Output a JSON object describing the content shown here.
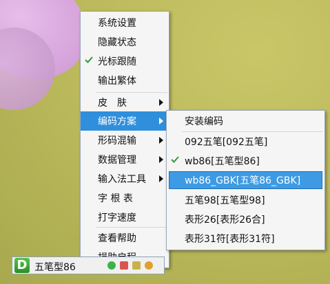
{
  "main_menu": {
    "items": [
      {
        "label": "系统设置",
        "checked": false,
        "submenu": false
      },
      {
        "label": "隐藏状态",
        "checked": false,
        "submenu": false
      },
      {
        "label": "光标跟随",
        "checked": true,
        "submenu": false
      },
      {
        "label": "输出繁体",
        "checked": false,
        "submenu": false
      },
      {
        "label": "皮　肤",
        "checked": false,
        "submenu": true
      },
      {
        "label": "编码方案",
        "checked": false,
        "submenu": true,
        "highlighted": true
      },
      {
        "label": "形码混输",
        "checked": false,
        "submenu": true
      },
      {
        "label": "数据管理",
        "checked": false,
        "submenu": true
      },
      {
        "label": "输入法工具",
        "checked": false,
        "submenu": true
      },
      {
        "label": "字 根 表",
        "checked": false,
        "submenu": false
      },
      {
        "label": "打字速度",
        "checked": false,
        "submenu": false
      },
      {
        "label": "查看帮助",
        "checked": false,
        "submenu": false
      },
      {
        "label": "捐助启程",
        "checked": false,
        "submenu": false
      }
    ]
  },
  "scheme_menu": {
    "items": [
      {
        "label": "安装编码",
        "checked": false
      },
      {
        "label": "092五笔[092五笔]",
        "checked": false
      },
      {
        "label": "wb86[五笔型86]",
        "checked": true
      },
      {
        "label": "wb86_GBK[五笔86_GBK]",
        "checked": false,
        "selected": true
      },
      {
        "label": "五笔98[五笔型98]",
        "checked": false
      },
      {
        "label": "表形26[表形26合]",
        "checked": false
      },
      {
        "label": "表形31符[表形31符]",
        "checked": false
      }
    ]
  },
  "statusbar": {
    "logo": "D",
    "scheme": "五笔型86"
  },
  "colors": {
    "highlight": "#2f8fdc",
    "check": "#2e9a3a",
    "logo": "#3aa832"
  }
}
